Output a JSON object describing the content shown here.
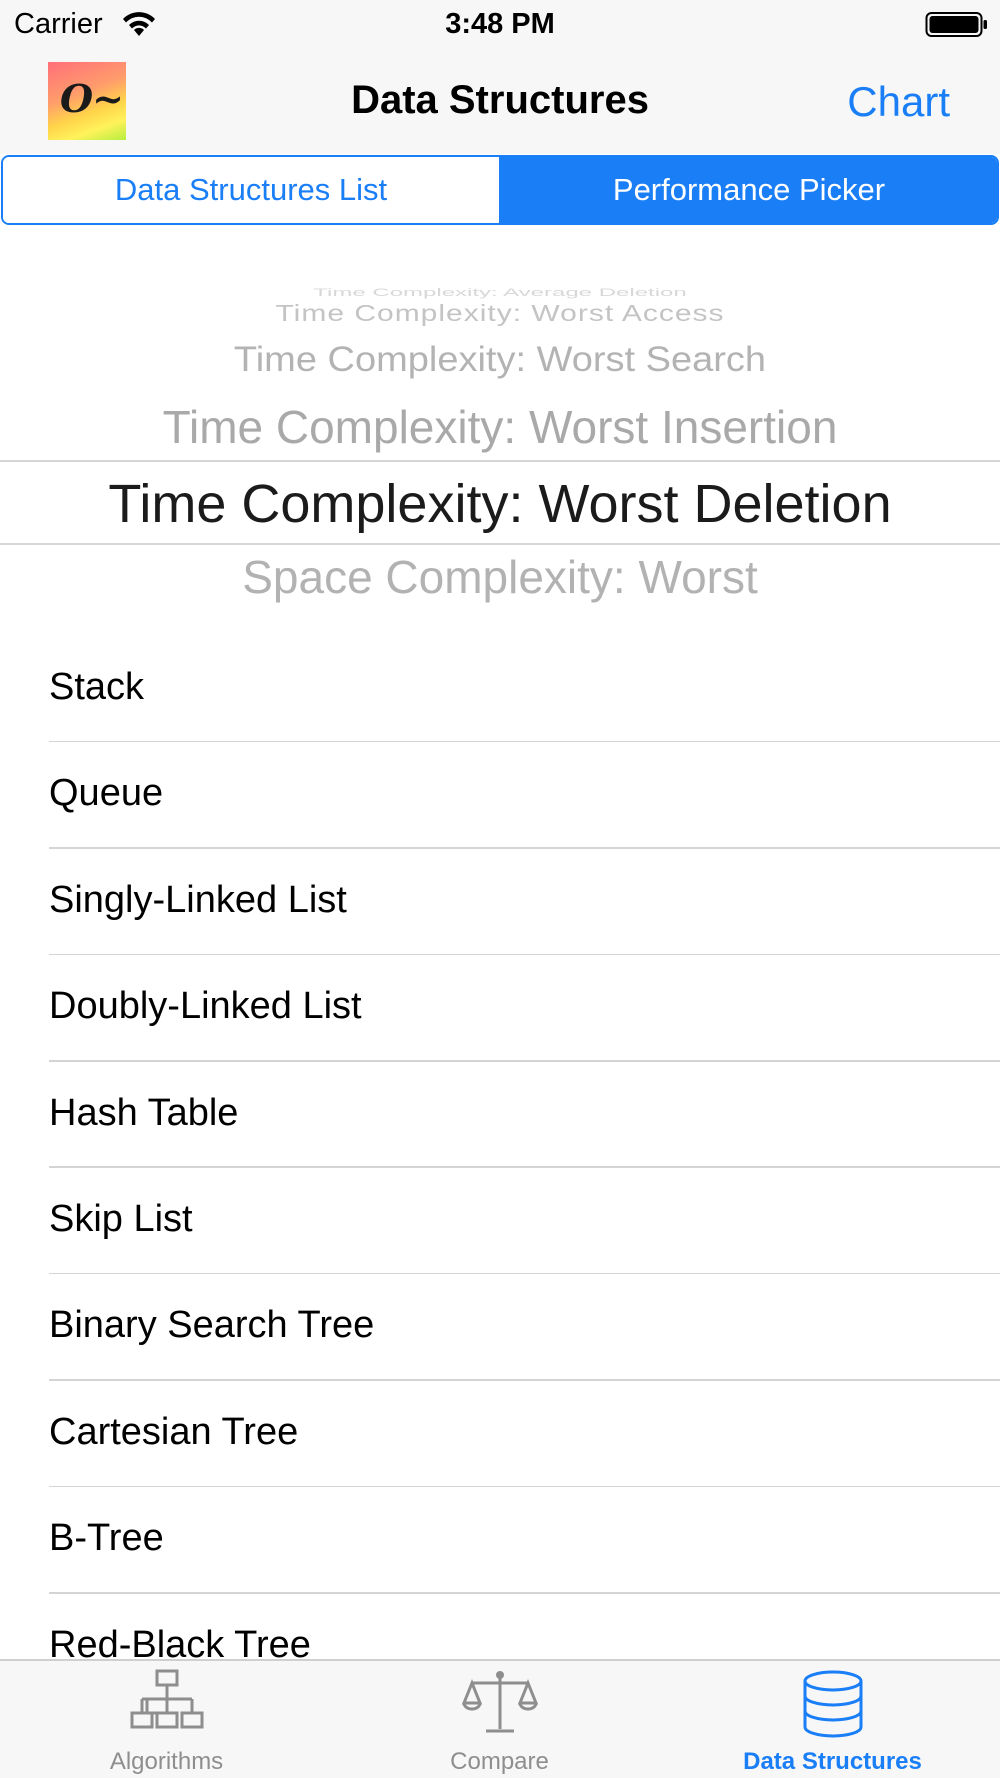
{
  "status_bar": {
    "carrier": "Carrier",
    "time": "3:48 PM"
  },
  "nav": {
    "logo_text": "O~",
    "title": "Data Structures",
    "right_button": "Chart"
  },
  "segmented": {
    "items": [
      "Data Structures List",
      "Performance Picker"
    ],
    "selected": "Performance Picker"
  },
  "picker": {
    "options": [
      "Time Complexity: Average Deletion",
      "Time Complexity: Worst Access",
      "Time Complexity: Worst Search",
      "Time Complexity: Worst Insertion",
      "Time Complexity: Worst Deletion",
      "Space Complexity: Worst"
    ],
    "selected": "Time Complexity: Worst Deletion"
  },
  "list": {
    "items": [
      "Stack",
      "Queue",
      "Singly-Linked List",
      "Doubly-Linked List",
      "Hash Table",
      "Skip List",
      "Binary Search Tree",
      "Cartesian Tree",
      "B-Tree",
      "Red-Black Tree"
    ]
  },
  "tab_bar": {
    "tabs": [
      {
        "label": "Algorithms",
        "icon": "hierarchy-icon"
      },
      {
        "label": "Compare",
        "icon": "scale-icon"
      },
      {
        "label": "Data Structures",
        "icon": "database-icon"
      }
    ],
    "active": "Data Structures"
  },
  "colors": {
    "accent": "#1a7ef7",
    "inactive_tab": "#8e8e8e",
    "bar_background": "#f7f7f7"
  }
}
